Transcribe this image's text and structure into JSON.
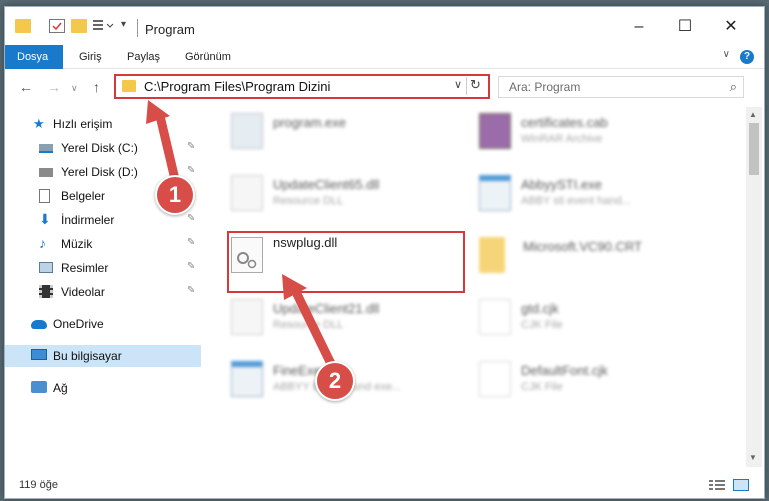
{
  "window": {
    "title": "Program"
  },
  "ribbon": {
    "tabs": [
      "Dosya",
      "Giriş",
      "Paylaş",
      "Görünüm"
    ]
  },
  "address": {
    "path": "C:\\Program Files\\Program Dizini"
  },
  "search": {
    "placeholder": "Ara: Program"
  },
  "sidebar": {
    "items": [
      {
        "label": "Hızlı erişim",
        "icon": "star-icon"
      },
      {
        "label": "Yerel Disk (C:)",
        "icon": "drive-icon"
      },
      {
        "label": "Yerel Disk (D:)",
        "icon": "drive-icon"
      },
      {
        "label": "Belgeler",
        "icon": "documents-icon"
      },
      {
        "label": "İndirmeler",
        "icon": "download-icon"
      },
      {
        "label": "Müzik",
        "icon": "music-icon"
      },
      {
        "label": "Resimler",
        "icon": "pictures-icon"
      },
      {
        "label": "Videolar",
        "icon": "video-icon"
      },
      {
        "label": "OneDrive",
        "icon": "cloud-icon"
      },
      {
        "label": "Bu bilgisayar",
        "icon": "computer-icon"
      },
      {
        "label": "Ağ",
        "icon": "network-icon"
      }
    ]
  },
  "files": [
    {
      "name": "program.exe",
      "sub": ""
    },
    {
      "name": "certificates.cab",
      "sub": "WinRAR Archive"
    },
    {
      "name": "UpdateClient65.dll",
      "sub": "Resource DLL"
    },
    {
      "name": "AbbyySTI.exe",
      "sub": "ABBY sti event hand..."
    },
    {
      "name": "nswplug.dll",
      "sub": ""
    },
    {
      "name": "Microsoft.VC90.CRT",
      "sub": ""
    },
    {
      "name": "UpdateClient21.dll",
      "sub": "Resource DLL"
    },
    {
      "name": "gtd.cjk",
      "sub": "CJK File"
    },
    {
      "name": "FineExe.exe",
      "sub": "ABBYY Background exe..."
    },
    {
      "name": "DefaultFont.cjk",
      "sub": "CJK File"
    }
  ],
  "status": {
    "count": "119 öğe"
  },
  "annotations": {
    "step1": "1",
    "step2": "2"
  },
  "colors": {
    "accent": "#1979ca",
    "highlight": "#d6393a",
    "folder": "#f3c84b"
  }
}
